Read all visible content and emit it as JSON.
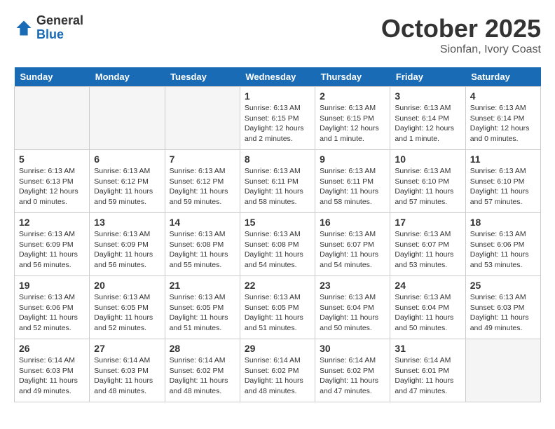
{
  "header": {
    "logo_general": "General",
    "logo_blue": "Blue",
    "month_title": "October 2025",
    "location": "Sionfan, Ivory Coast"
  },
  "weekdays": [
    "Sunday",
    "Monday",
    "Tuesday",
    "Wednesday",
    "Thursday",
    "Friday",
    "Saturday"
  ],
  "weeks": [
    [
      {
        "day": "",
        "info": ""
      },
      {
        "day": "",
        "info": ""
      },
      {
        "day": "",
        "info": ""
      },
      {
        "day": "1",
        "info": "Sunrise: 6:13 AM\nSunset: 6:15 PM\nDaylight: 12 hours\nand 2 minutes."
      },
      {
        "day": "2",
        "info": "Sunrise: 6:13 AM\nSunset: 6:15 PM\nDaylight: 12 hours\nand 1 minute."
      },
      {
        "day": "3",
        "info": "Sunrise: 6:13 AM\nSunset: 6:14 PM\nDaylight: 12 hours\nand 1 minute."
      },
      {
        "day": "4",
        "info": "Sunrise: 6:13 AM\nSunset: 6:14 PM\nDaylight: 12 hours\nand 0 minutes."
      }
    ],
    [
      {
        "day": "5",
        "info": "Sunrise: 6:13 AM\nSunset: 6:13 PM\nDaylight: 12 hours\nand 0 minutes."
      },
      {
        "day": "6",
        "info": "Sunrise: 6:13 AM\nSunset: 6:12 PM\nDaylight: 11 hours\nand 59 minutes."
      },
      {
        "day": "7",
        "info": "Sunrise: 6:13 AM\nSunset: 6:12 PM\nDaylight: 11 hours\nand 59 minutes."
      },
      {
        "day": "8",
        "info": "Sunrise: 6:13 AM\nSunset: 6:11 PM\nDaylight: 11 hours\nand 58 minutes."
      },
      {
        "day": "9",
        "info": "Sunrise: 6:13 AM\nSunset: 6:11 PM\nDaylight: 11 hours\nand 58 minutes."
      },
      {
        "day": "10",
        "info": "Sunrise: 6:13 AM\nSunset: 6:10 PM\nDaylight: 11 hours\nand 57 minutes."
      },
      {
        "day": "11",
        "info": "Sunrise: 6:13 AM\nSunset: 6:10 PM\nDaylight: 11 hours\nand 57 minutes."
      }
    ],
    [
      {
        "day": "12",
        "info": "Sunrise: 6:13 AM\nSunset: 6:09 PM\nDaylight: 11 hours\nand 56 minutes."
      },
      {
        "day": "13",
        "info": "Sunrise: 6:13 AM\nSunset: 6:09 PM\nDaylight: 11 hours\nand 56 minutes."
      },
      {
        "day": "14",
        "info": "Sunrise: 6:13 AM\nSunset: 6:08 PM\nDaylight: 11 hours\nand 55 minutes."
      },
      {
        "day": "15",
        "info": "Sunrise: 6:13 AM\nSunset: 6:08 PM\nDaylight: 11 hours\nand 54 minutes."
      },
      {
        "day": "16",
        "info": "Sunrise: 6:13 AM\nSunset: 6:07 PM\nDaylight: 11 hours\nand 54 minutes."
      },
      {
        "day": "17",
        "info": "Sunrise: 6:13 AM\nSunset: 6:07 PM\nDaylight: 11 hours\nand 53 minutes."
      },
      {
        "day": "18",
        "info": "Sunrise: 6:13 AM\nSunset: 6:06 PM\nDaylight: 11 hours\nand 53 minutes."
      }
    ],
    [
      {
        "day": "19",
        "info": "Sunrise: 6:13 AM\nSunset: 6:06 PM\nDaylight: 11 hours\nand 52 minutes."
      },
      {
        "day": "20",
        "info": "Sunrise: 6:13 AM\nSunset: 6:05 PM\nDaylight: 11 hours\nand 52 minutes."
      },
      {
        "day": "21",
        "info": "Sunrise: 6:13 AM\nSunset: 6:05 PM\nDaylight: 11 hours\nand 51 minutes."
      },
      {
        "day": "22",
        "info": "Sunrise: 6:13 AM\nSunset: 6:05 PM\nDaylight: 11 hours\nand 51 minutes."
      },
      {
        "day": "23",
        "info": "Sunrise: 6:13 AM\nSunset: 6:04 PM\nDaylight: 11 hours\nand 50 minutes."
      },
      {
        "day": "24",
        "info": "Sunrise: 6:13 AM\nSunset: 6:04 PM\nDaylight: 11 hours\nand 50 minutes."
      },
      {
        "day": "25",
        "info": "Sunrise: 6:13 AM\nSunset: 6:03 PM\nDaylight: 11 hours\nand 49 minutes."
      }
    ],
    [
      {
        "day": "26",
        "info": "Sunrise: 6:14 AM\nSunset: 6:03 PM\nDaylight: 11 hours\nand 49 minutes."
      },
      {
        "day": "27",
        "info": "Sunrise: 6:14 AM\nSunset: 6:03 PM\nDaylight: 11 hours\nand 48 minutes."
      },
      {
        "day": "28",
        "info": "Sunrise: 6:14 AM\nSunset: 6:02 PM\nDaylight: 11 hours\nand 48 minutes."
      },
      {
        "day": "29",
        "info": "Sunrise: 6:14 AM\nSunset: 6:02 PM\nDaylight: 11 hours\nand 48 minutes."
      },
      {
        "day": "30",
        "info": "Sunrise: 6:14 AM\nSunset: 6:02 PM\nDaylight: 11 hours\nand 47 minutes."
      },
      {
        "day": "31",
        "info": "Sunrise: 6:14 AM\nSunset: 6:01 PM\nDaylight: 11 hours\nand 47 minutes."
      },
      {
        "day": "",
        "info": ""
      }
    ]
  ]
}
